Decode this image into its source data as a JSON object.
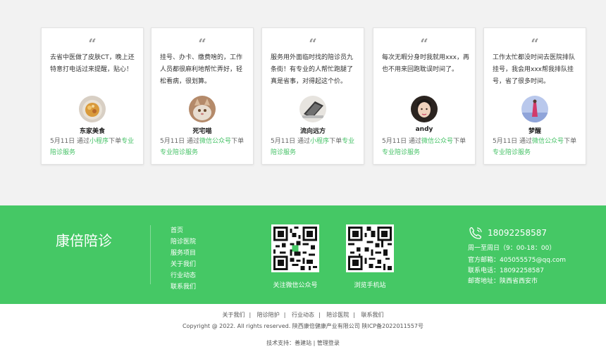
{
  "testimonials": [
    {
      "text": "去省中医做了皮肤CT，晚上还特意打电话过来提醒，贴心！",
      "name": "东家美食",
      "date": "5月11日 通过",
      "channel": "小程序",
      "mid": "下单",
      "service": "专业陪诊服务",
      "avatar_icon": "food-bowl-icon"
    },
    {
      "text": "挂号、办卡、缴费啥的，工作人员都很麻利地帮忙弄好，轻松看病，很划算。",
      "name": "死宅喵",
      "date": "5月11日 通过",
      "channel": "微信公众号",
      "mid": "下单",
      "service": "专业陪诊服务",
      "avatar_icon": "cat-icon"
    },
    {
      "text": "服务用外面临时找的陪诊员九条街！有专业的人帮忙跑腿了真是省事，对得起这个价。",
      "name": "流向远方",
      "date": "5月11日 通过",
      "channel": "小程序",
      "mid": "下单",
      "service": "专业陪诊服务",
      "avatar_icon": "laptop-icon"
    },
    {
      "text": "每次无暇分身时我就用xxx，再也不用来回跑耽误时间了。",
      "name": "andy",
      "date": "5月11日 通过",
      "channel": "微信公众号",
      "mid": "下单",
      "service": "专业陪诊服务",
      "avatar_icon": "woman-portrait-icon"
    },
    {
      "text": "工作太忙都没时间去医院排队挂号，我会用xxx帮我排队挂号，省了很多时间。",
      "name": "梦醒",
      "date": "5月11日 通过",
      "channel": "微信公众号",
      "mid": "下单",
      "service": "专业陪诊服务",
      "avatar_icon": "figure-sky-icon"
    }
  ],
  "quote_mark": "“",
  "footer": {
    "brand": "康倍陪诊",
    "nav": [
      "首页",
      "陪诊医院",
      "服务项目",
      "关于我们",
      "行业动态",
      "联系我们"
    ],
    "qr": [
      {
        "caption": "关注微信公众号",
        "icon": "qr-code-icon"
      },
      {
        "caption": "浏览手机站",
        "icon": "qr-code-icon"
      }
    ],
    "contact": {
      "phone": "18092258587",
      "phone_icon": "phone-icon",
      "hours": "周一至周日（9：00-18：00）",
      "email": "官方邮箱：405055575@qq.com",
      "tel": "联系电话：18092258587",
      "address": "邮寄地址：陕西省西安市"
    }
  },
  "bottom": {
    "links": [
      "关于我们",
      "陪诊陪护",
      "行业动态",
      "陪诊医院",
      "联系我们"
    ],
    "separator": "|",
    "copyright": "Copyright @ 2022. All rights reserved.  陕西康倍健康产业有限公司   陕ICP备2022011557号",
    "support": "技术支持：",
    "support_link": "善建站",
    "admin_sep": " | ",
    "admin": "管理登录"
  },
  "colors": {
    "green": "#45c865",
    "link_green": "#45c266"
  }
}
